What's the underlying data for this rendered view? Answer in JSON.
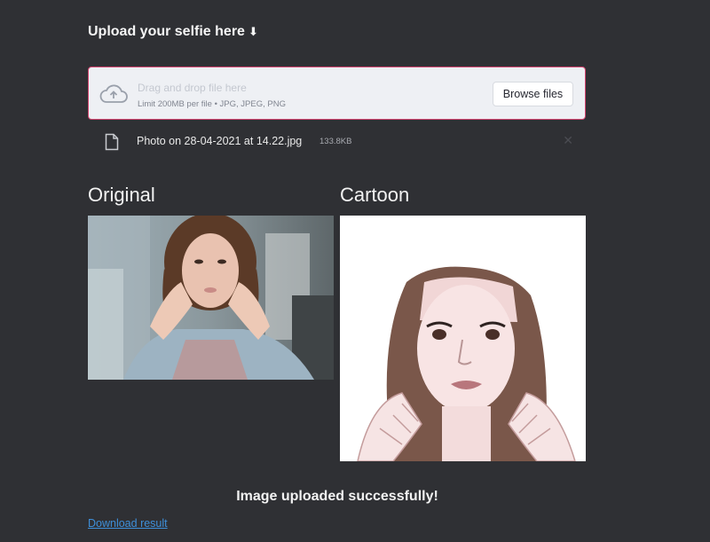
{
  "upload": {
    "heading": "Upload your selfie here",
    "heading_icon": "down-arrow-icon",
    "drag_text": "Drag and drop file here",
    "limit_text": "Limit 200MB per file • JPG, JPEG, PNG",
    "browse_label": "Browse files"
  },
  "file": {
    "name": "Photo on 28-04-2021 at 14.22.jpg",
    "size": "133.8KB",
    "close_glyph": "✕"
  },
  "results": {
    "original_title": "Original",
    "cartoon_title": "Cartoon"
  },
  "status": {
    "message": "Image uploaded successfully!"
  },
  "download": {
    "label": "Download result"
  },
  "colors": {
    "background": "#2f3034",
    "dropzone_border": "#d3446f",
    "link": "#3e8fd9"
  }
}
